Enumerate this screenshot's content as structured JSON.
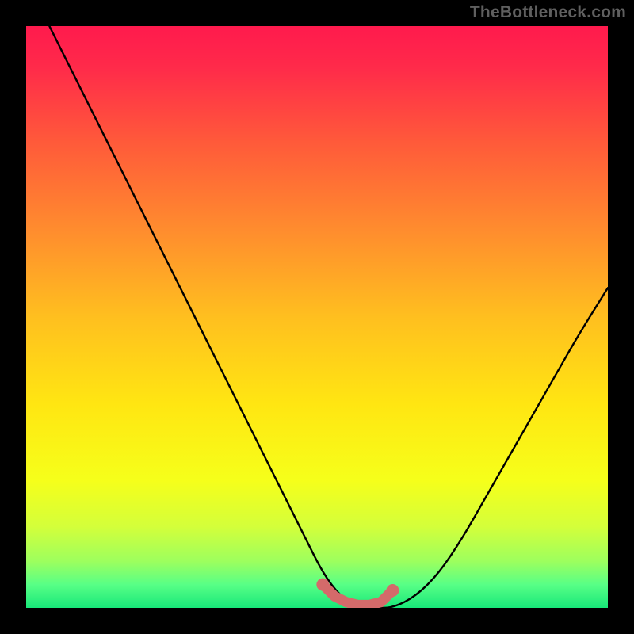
{
  "watermark": "TheBottleneck.com",
  "colors": {
    "frame": "#000000",
    "gradient_stops": [
      {
        "offset": 0.0,
        "color": "#ff1a4d"
      },
      {
        "offset": 0.07,
        "color": "#ff2a4a"
      },
      {
        "offset": 0.2,
        "color": "#ff5a3a"
      },
      {
        "offset": 0.35,
        "color": "#ff8c2e"
      },
      {
        "offset": 0.5,
        "color": "#ffbf1f"
      },
      {
        "offset": 0.65,
        "color": "#ffe612"
      },
      {
        "offset": 0.78,
        "color": "#f6ff1a"
      },
      {
        "offset": 0.86,
        "color": "#d4ff3a"
      },
      {
        "offset": 0.92,
        "color": "#9dff5e"
      },
      {
        "offset": 0.96,
        "color": "#58ff86"
      },
      {
        "offset": 1.0,
        "color": "#18e879"
      }
    ],
    "curve": "#000000",
    "marker": "#d46a6a"
  },
  "chart_data": {
    "type": "line",
    "title": "",
    "xlabel": "",
    "ylabel": "",
    "xlim": [
      0,
      100
    ],
    "ylim": [
      0,
      100
    ],
    "grid": false,
    "legend": false,
    "series": [
      {
        "name": "bottleneck-curve",
        "x": [
          4,
          8,
          12,
          16,
          20,
          24,
          28,
          32,
          36,
          40,
          44,
          48,
          51,
          54,
          57,
          60,
          63,
          67,
          71,
          75,
          79,
          83,
          87,
          91,
          95,
          100
        ],
        "y": [
          100,
          92,
          84,
          76,
          68,
          60,
          52,
          44,
          36,
          28,
          20,
          12,
          6,
          2,
          0,
          0,
          0,
          2,
          6,
          12,
          19,
          26,
          33,
          40,
          47,
          55
        ]
      }
    ],
    "markers": {
      "name": "optimal-range",
      "x": [
        51,
        53,
        55,
        57,
        59,
        61,
        63
      ],
      "y": [
        4,
        2,
        1,
        0.5,
        0.5,
        1,
        3
      ]
    }
  }
}
